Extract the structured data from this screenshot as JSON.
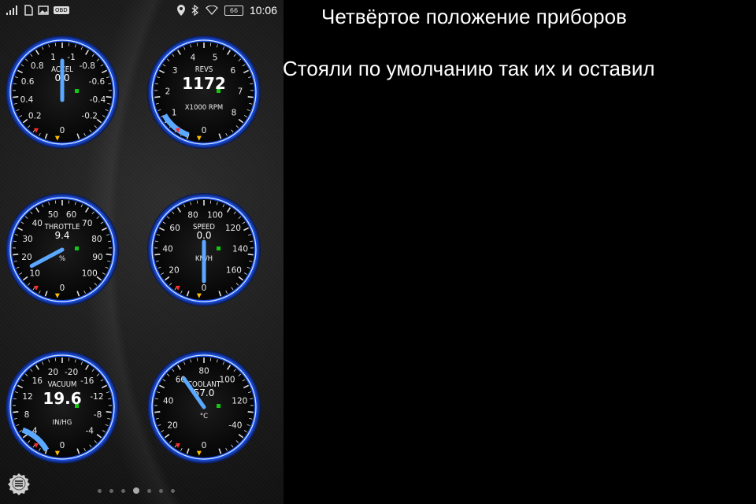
{
  "status_bar": {
    "time": "10:06",
    "battery": "66",
    "icons": [
      "signal-icon",
      "sim-icon",
      "image-icon",
      "obd-icon",
      "location-icon",
      "bluetooth-icon",
      "wifi-icon",
      "battery-icon"
    ],
    "obd_label": "OBD"
  },
  "colors": {
    "ring": "#1e5bff",
    "needle": "#5aa8ff",
    "accent_green": "#12c812",
    "warn_red": "#ff2a2a",
    "warn_yellow": "#ffc000"
  },
  "gauges": [
    {
      "id": "accel",
      "title": "ACCEL",
      "value": "0.0",
      "unit": "",
      "ticks": [
        "0.2",
        "0.4",
        "0.6",
        "0.8",
        "1",
        "-1",
        "-0.8",
        "-0.6",
        "-0.4",
        "-0.2"
      ],
      "bottom": "0",
      "needle_fraction": 0.5,
      "arc": false
    },
    {
      "id": "revs",
      "title": "REVS",
      "value": "1172",
      "unit": "X1000 RPM",
      "ticks": [
        "1",
        "2",
        "3",
        "4",
        "5",
        "6",
        "7",
        "8"
      ],
      "bottom": "0",
      "needle_fraction": 0.15,
      "arc": true
    },
    {
      "id": "throttle",
      "title": "THROTTLE",
      "value": "9.4",
      "unit": "%",
      "ticks": [
        "10",
        "20",
        "30",
        "40",
        "50",
        "60",
        "70",
        "80",
        "90",
        "100"
      ],
      "bottom": "0",
      "needle_fraction": 0.094,
      "arc": false
    },
    {
      "id": "speed",
      "title": "SPEED",
      "value": "0.0",
      "unit": "KM/H",
      "ticks": [
        "20",
        "40",
        "60",
        "80",
        "100",
        "120",
        "140",
        "160"
      ],
      "bottom": "0",
      "needle_fraction": 0.0,
      "arc": false
    },
    {
      "id": "vacuum",
      "title": "VACUUM",
      "value": "19.6",
      "unit": "IN/HG",
      "ticks": [
        "4",
        "8",
        "12",
        "16",
        "20",
        "-20",
        "-16",
        "-12",
        "-8",
        "-4"
      ],
      "bottom": "0",
      "needle_fraction": 0.0,
      "arc": true
    },
    {
      "id": "coolant",
      "title": "COOLANT",
      "value": "57.0",
      "unit": "°C",
      "ticks": [
        "20",
        "40",
        "60",
        "80",
        "100",
        "120",
        "-40"
      ],
      "bottom": "0",
      "needle_fraction": 0.375,
      "arc": false
    }
  ],
  "captions": {
    "line1": "Четвёртое положение приборов",
    "line2": "Стояли по умолчанию так их и оставил"
  },
  "pager": {
    "count": 7,
    "active_index": 3
  }
}
